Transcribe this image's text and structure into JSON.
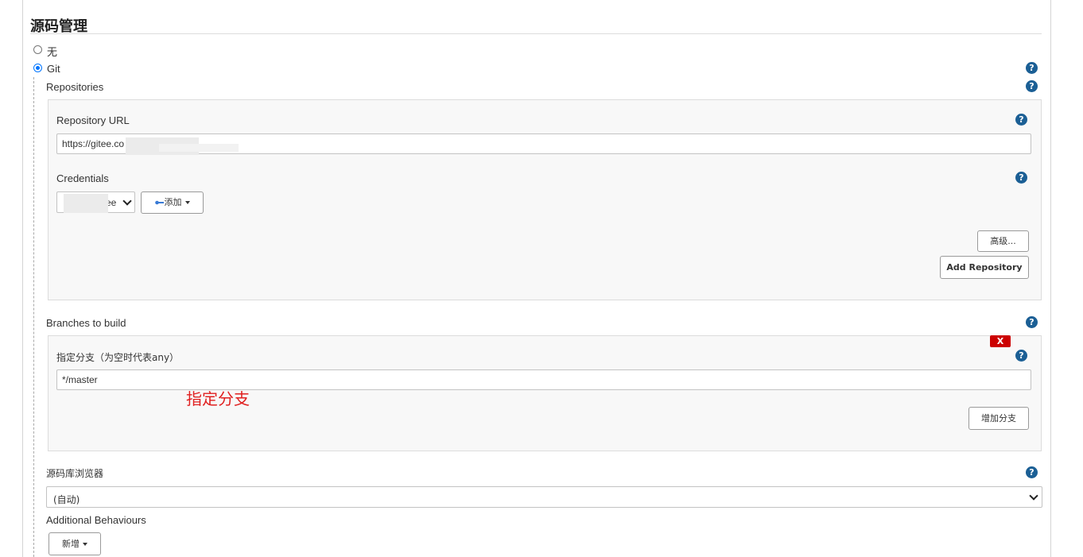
{
  "section": {
    "title": "源码管理"
  },
  "scm_options": [
    {
      "label": "无",
      "selected": false
    },
    {
      "label": "Git",
      "selected": true
    }
  ],
  "repositories": {
    "label": "Repositories",
    "url_label": "Repository URL",
    "url_value": "https://gitee.co",
    "credentials_label": "Credentials",
    "credentials_value": "ee",
    "add_button": "添加",
    "advanced_button": "高级...",
    "add_repository_button": "Add Repository"
  },
  "branches": {
    "label": "Branches to build",
    "delete_button": "X",
    "branch_spec_label": "指定分支（为空时代表any）",
    "branch_spec_value": "*/master",
    "annotation": "指定分支",
    "add_branch_button": "增加分支"
  },
  "browser": {
    "label": "源码库浏览器",
    "selected": "(自动)"
  },
  "additional": {
    "label": "Additional Behaviours",
    "add_button": "新增"
  },
  "help_icon_text": "?",
  "colors": {
    "help": "#1b5f95",
    "delete": "#cc0000",
    "annotation": "#e02020",
    "radio": "#0075ff"
  }
}
